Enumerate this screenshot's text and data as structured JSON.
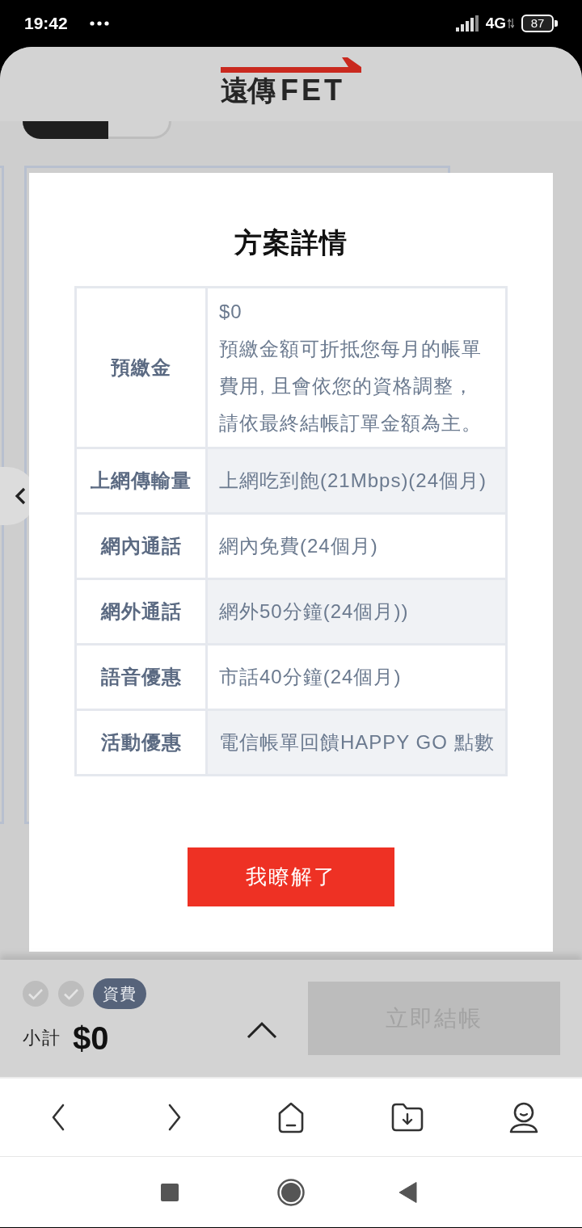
{
  "status_bar": {
    "time": "19:42",
    "network": "4G",
    "battery": "87"
  },
  "header": {
    "logo": {
      "chinese": "遠傳",
      "latin": "FET"
    }
  },
  "background": {
    "network_tabs": [
      {
        "selected": true
      },
      {
        "selected": false
      }
    ]
  },
  "dialog": {
    "title": "方案詳情",
    "rows": [
      {
        "label": "預繳金",
        "value": "$0",
        "note": "預繳金額可折抵您每月的帳單費用, 且會依您的資格調整，請依最終結帳訂單金額為主。"
      },
      {
        "label": "上網傳輸量",
        "value": "上網吃到飽(21Mbps)(24個月)"
      },
      {
        "label": "網內通話",
        "value": "網內免費(24個月)"
      },
      {
        "label": "網外通話",
        "value": "網外50分鐘(24個月))"
      },
      {
        "label": "語音優惠",
        "value": "市話40分鐘(24個月)"
      },
      {
        "label": "活動優惠",
        "value": "電信帳單回饋HAPPY GO 點數"
      }
    ],
    "confirm_button": "我瞭解了"
  },
  "checkout_bar": {
    "steps": [
      {
        "done": false
      },
      {
        "done": false
      }
    ],
    "badge": "資費",
    "subtotal_label": "小計",
    "subtotal": "$0",
    "checkout_button": {
      "label": "立即結帳",
      "disabled": true
    }
  }
}
